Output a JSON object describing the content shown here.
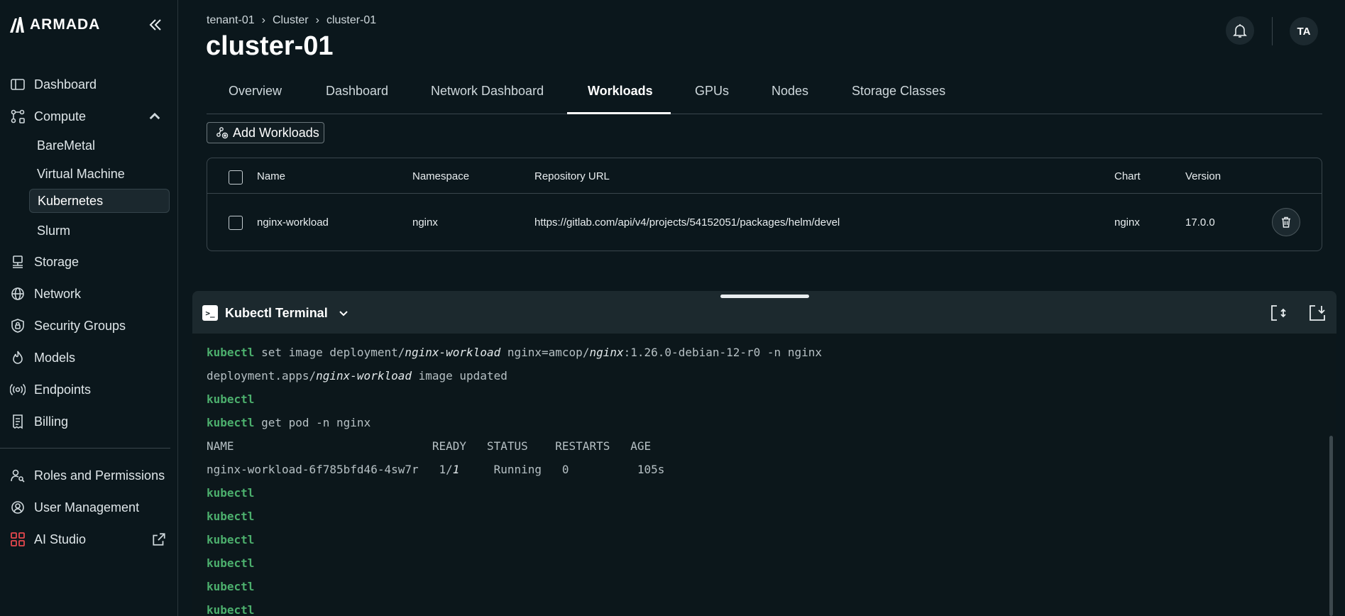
{
  "brand": {
    "name": "ARMADA"
  },
  "sidebar": {
    "items": [
      {
        "label": "Dashboard",
        "icon": "layout-panel-icon"
      },
      {
        "label": "Compute",
        "icon": "compute-nodes-icon"
      },
      {
        "label": "Storage",
        "icon": "storage-icon"
      },
      {
        "label": "Network",
        "icon": "globe-icon"
      },
      {
        "label": "Security Groups",
        "icon": "shield-lock-icon"
      },
      {
        "label": "Models",
        "icon": "flame-icon"
      },
      {
        "label": "Endpoints",
        "icon": "broadcast-icon"
      },
      {
        "label": "Billing",
        "icon": "receipt-icon"
      },
      {
        "label": "Roles and Permissions",
        "icon": "users-key-icon"
      },
      {
        "label": "User Management",
        "icon": "user-gear-icon"
      },
      {
        "label": "AI Studio",
        "icon": "grid-apps-icon"
      }
    ],
    "compute_sub": [
      "BareMetal",
      "Virtual Machine",
      "Kubernetes",
      "Slurm"
    ]
  },
  "header": {
    "breadcrumb": [
      "tenant-01",
      "Cluster",
      "cluster-01"
    ],
    "title": "cluster-01",
    "avatar": "TA"
  },
  "tabs": [
    "Overview",
    "Dashboard",
    "Network Dashboard",
    "Workloads",
    "GPUs",
    "Nodes",
    "Storage Classes"
  ],
  "active_tab": "Workloads",
  "add_button": "Add Workloads",
  "table": {
    "columns": [
      "Name",
      "Namespace",
      "Repository URL",
      "Chart",
      "Version"
    ],
    "rows": [
      {
        "name": "nginx-workload",
        "namespace": "nginx",
        "repo": "https://gitlab.com/api/v4/projects/54152051/packages/helm/devel",
        "chart": "nginx",
        "version": "17.0.0"
      }
    ]
  },
  "terminal": {
    "title": "Kubectl Terminal",
    "prompt": "kubectl",
    "lines": {
      "l1_cmd": " set image deployment/",
      "l1_a": "nginx-workload",
      "l1_b": " nginx=amcop/",
      "l1_c": "nginx",
      "l1_d": ":1.26.0-debian-12-r0 -n nginx",
      "l2_a": "deployment.apps/",
      "l2_b": "nginx-workload",
      "l2_c": " image updated",
      "l4_cmd": " get pod -n nginx",
      "hdr": "NAME                             READY   STATUS    RESTARTS   AGE",
      "pod_a": "nginx-workload-6f785bfd46-4sw7r   1/",
      "pod_b": "1",
      "pod_c": "     Running   0          105s"
    }
  },
  "colors": {
    "accent_green": "#4caf6d",
    "background": "#0b171c",
    "panel": "#1c292e"
  }
}
